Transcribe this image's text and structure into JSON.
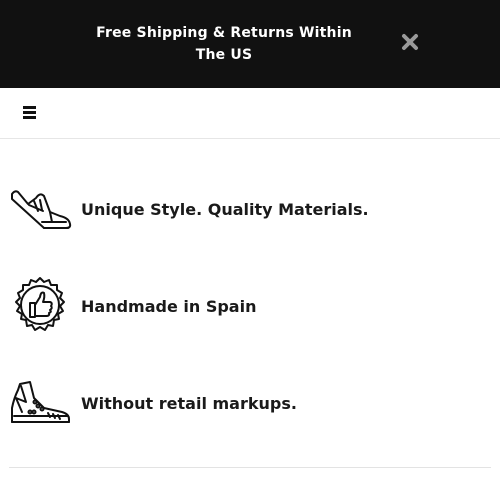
{
  "announcement": {
    "text": "Free Shipping & Returns Within The US",
    "close_icon": "close-icon",
    "background": "#111111",
    "text_color": "#ffffff"
  },
  "header": {
    "menu_icon": "hamburger-menu-icon"
  },
  "features": [
    {
      "icon": "sneaker-icon",
      "label": "Unique Style. Quality Materials."
    },
    {
      "icon": "thumbs-up-badge-icon",
      "label": "Handmade in Spain"
    },
    {
      "icon": "high-top-sneaker-icon",
      "label": "Without retail markups."
    }
  ]
}
